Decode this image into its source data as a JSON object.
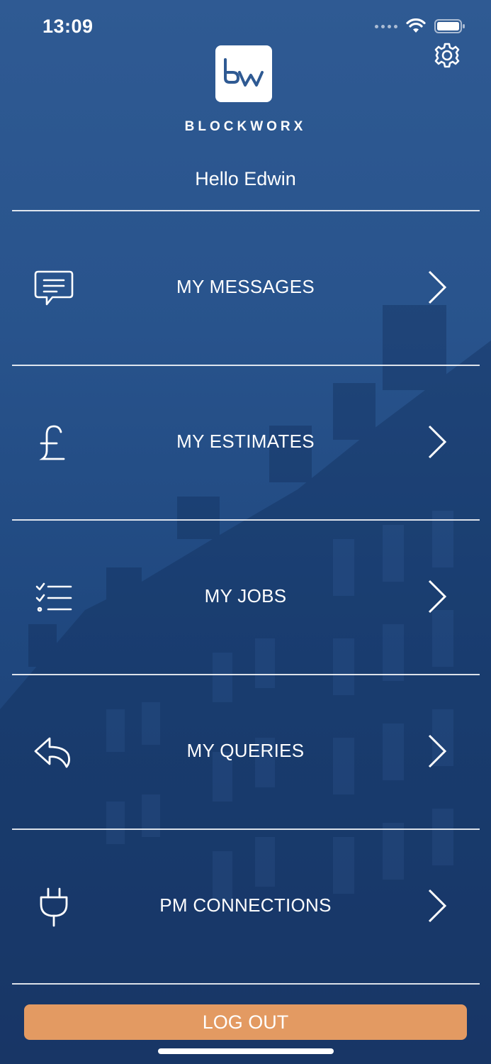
{
  "status_bar": {
    "time": "13:09"
  },
  "brand": {
    "name": "BLOCKWORX"
  },
  "greeting": "Hello Edwin",
  "menu": [
    {
      "label": "MY MESSAGES",
      "icon": "chat-icon"
    },
    {
      "label": "MY ESTIMATES",
      "icon": "pound-icon"
    },
    {
      "label": "MY JOBS",
      "icon": "checklist-icon"
    },
    {
      "label": "MY QUERIES",
      "icon": "reply-icon"
    },
    {
      "label": "PM CONNECTIONS",
      "icon": "plug-icon"
    }
  ],
  "logout_label": "LOG OUT",
  "colors": {
    "background": "#2f5a93",
    "logout": "#e39a62",
    "text": "#ffffff"
  }
}
